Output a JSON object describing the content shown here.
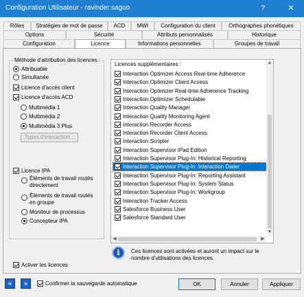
{
  "window": {
    "title": "Configuration Utilisateur - ravinder.sagoo",
    "help_glyph": "?",
    "close_glyph": "✕"
  },
  "tabs": {
    "row1": [
      "Rôles",
      "Stratégies de mot de passe",
      "ACD",
      "MWI",
      "Configuration du client",
      "Orthographes phonétiques"
    ],
    "row2": [
      "Options",
      "Sécurité",
      "Attributs personnalisés",
      "Historique"
    ],
    "row3": [
      "Configuration",
      "Licence",
      "Informations personnelles",
      "Groupes de travail"
    ],
    "active": "Licence"
  },
  "left": {
    "method_heading": "Méthode d'attribution des licences :",
    "method_options": [
      {
        "label": "Attribuable",
        "selected": true
      },
      {
        "label": "Simultanée",
        "selected": false
      }
    ],
    "client_access": {
      "label": "Licence d'accès client",
      "checked": true
    },
    "acd_access": {
      "label": "Licence d'accès ACD",
      "checked": true
    },
    "multimedia_options": [
      {
        "label": "Multimédia 1",
        "selected": false
      },
      {
        "label": "Multimédia 2",
        "selected": false
      },
      {
        "label": "Multimédia 3 Plus",
        "selected": true
      }
    ],
    "interaction_types_button": "Types d'interaction...",
    "ipa": {
      "label": "Licence IPA",
      "checked": true
    },
    "ipa_options": [
      {
        "line1": "Éléments de travail routés",
        "line2": "directement",
        "selected": false
      },
      {
        "line1": "Éléments de travail routés",
        "line2": "en groupe",
        "selected": false
      },
      {
        "line1": "Moniteur de processus",
        "line2": "",
        "selected": false
      },
      {
        "line1": "Concepteur IPA",
        "line2": "",
        "selected": true
      }
    ],
    "activate_licenses": {
      "label": "Activer les licences",
      "checked": true
    }
  },
  "right": {
    "additional_heading": "Licences supplémentaires :",
    "licenses": [
      {
        "label": "Interaction Optimizer Access Real-time Adherence",
        "checked": true,
        "selected": false
      },
      {
        "label": "Interaction Optimizer Client Access",
        "checked": true,
        "selected": false
      },
      {
        "label": "Interaction Optimizer Real-time Adherence Tracking",
        "checked": true,
        "selected": false
      },
      {
        "label": "Interaction Optimizer Schedulable",
        "checked": true,
        "selected": false
      },
      {
        "label": "Interaction Quality Manager",
        "checked": true,
        "selected": false
      },
      {
        "label": "Interaction Quality Monitoring Agent",
        "checked": true,
        "selected": false
      },
      {
        "label": "Interaction Recorder Access",
        "checked": true,
        "selected": false
      },
      {
        "label": "Interaction Recorder Client Access",
        "checked": true,
        "selected": false
      },
      {
        "label": "Interaction Scripter",
        "checked": true,
        "selected": false
      },
      {
        "label": "Interaction Supervisor iPad Edition",
        "checked": true,
        "selected": false
      },
      {
        "label": "Interaction Supervisor Plug-In: Historical Reporting",
        "checked": true,
        "selected": false
      },
      {
        "label": "Interaction Supervisor Plug-In: Interaction Dialer",
        "checked": true,
        "selected": true
      },
      {
        "label": "Interaction Supervisor Plug-In: Reporting Assistant",
        "checked": true,
        "selected": false
      },
      {
        "label": "Interaction Supervisor Plug-In: System Status",
        "checked": true,
        "selected": false
      },
      {
        "label": "Interaction Supervisor Plug-In: Workgroup",
        "checked": true,
        "selected": false
      },
      {
        "label": "Interaction Tracker Access",
        "checked": true,
        "selected": false
      },
      {
        "label": "Salesforce Business User",
        "checked": true,
        "selected": false
      },
      {
        "label": "Salesforce Standard User",
        "checked": true,
        "selected": false
      }
    ],
    "info_text_line1": "Ces licences sont activées et auront un impact sur le",
    "info_text_line2": "nombre d'utilisations des licences.",
    "info_icon_glyph": "i"
  },
  "bottom": {
    "prev_glyph": "«",
    "next_glyph": "»",
    "autosave": {
      "label": "Confirmer la sauvegarde automatique",
      "checked": true
    },
    "ok": "OK",
    "cancel": "Annuler",
    "apply": "Appliquer"
  }
}
